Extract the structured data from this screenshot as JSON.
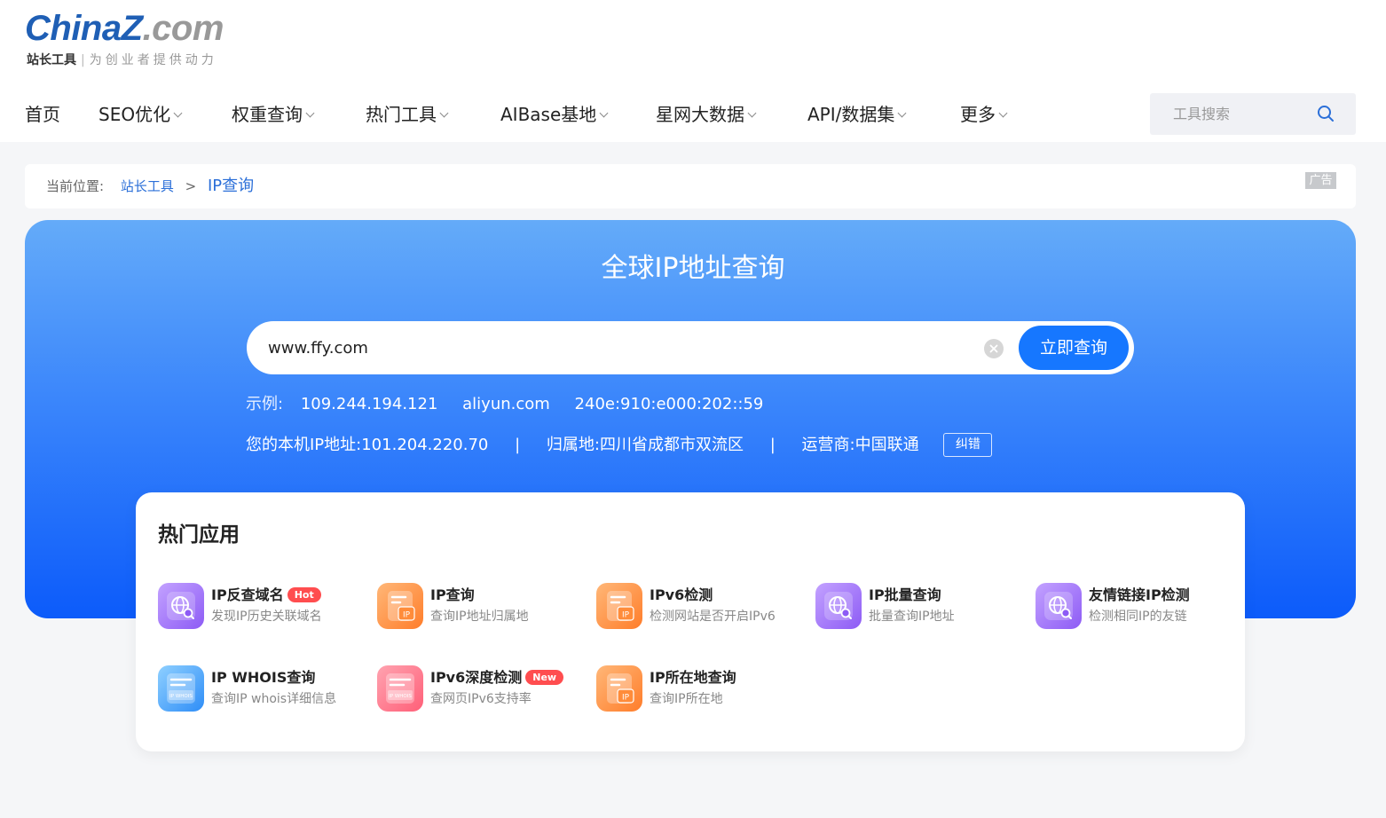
{
  "logo": {
    "brand_a": "China",
    "brand_z": "Z",
    "brand_b": ".com",
    "name": "站长工具",
    "slogan": "为创业者提供动力"
  },
  "nav": {
    "items": [
      {
        "label": "首页",
        "dropdown": false
      },
      {
        "label": "SEO优化",
        "dropdown": true
      },
      {
        "label": "权重查询",
        "dropdown": true
      },
      {
        "label": "热门工具",
        "dropdown": true
      },
      {
        "label": "AIBase基地",
        "dropdown": true
      },
      {
        "label": "星网大数据",
        "dropdown": true
      },
      {
        "label": "API/数据集",
        "dropdown": true
      },
      {
        "label": "更多",
        "dropdown": true
      }
    ],
    "search_placeholder": "工具搜索"
  },
  "breadcrumb": {
    "prefix": "当前位置:",
    "home": "站长工具",
    "separator": ">",
    "current": "IP查询",
    "ad_label": "广告"
  },
  "hero": {
    "title": "全球IP地址查询",
    "query_value": "www.ffy.com",
    "query_button": "立即查询",
    "examples_label": "示例:",
    "examples": [
      "109.244.194.121",
      "aliyun.com",
      "240e:910:e000:202::59"
    ],
    "local_ip_label": "您的本机IP地址:",
    "local_ip": "101.204.220.70",
    "divider": "|",
    "location_label": "归属地:",
    "location": "四川省成都市双流区",
    "isp_label": "运营商:",
    "isp": "中国联通",
    "fix_button": "纠错"
  },
  "hot_apps": {
    "title": "热门应用",
    "items": [
      {
        "name": "IP反查域名",
        "desc": "发现IP历史关联域名",
        "tag": "Hot",
        "icon": "globe-search-icon",
        "color": "purple"
      },
      {
        "name": "IP查询",
        "desc": "查询IP地址归属地",
        "tag": "",
        "icon": "ip-doc-icon",
        "color": "orange"
      },
      {
        "name": "IPv6检测",
        "desc": "检测网站是否开启IPv6",
        "tag": "",
        "icon": "ip-doc-icon",
        "color": "orange"
      },
      {
        "name": "IP批量查询",
        "desc": "批量查询IP地址",
        "tag": "",
        "icon": "globe-search-icon",
        "color": "purple"
      },
      {
        "name": "友情链接IP检测",
        "desc": "检测相同IP的友链",
        "tag": "",
        "icon": "globe-search-icon",
        "color": "purple"
      },
      {
        "name": "IP WHOIS查询",
        "desc": "查询IP whois详细信息",
        "tag": "",
        "icon": "whois-doc-icon",
        "color": "blue",
        "icon_text": "IP WHOIS"
      },
      {
        "name": "IPv6深度检测",
        "desc": "查网页IPv6支持率",
        "tag": "New",
        "icon": "whois-doc-icon",
        "color": "pink",
        "icon_text": "IP WHOIS"
      },
      {
        "name": "IP所在地查询",
        "desc": "查询IP所在地",
        "tag": "",
        "icon": "ip-doc-icon",
        "color": "orange"
      }
    ]
  },
  "icon_glyph": "IP"
}
